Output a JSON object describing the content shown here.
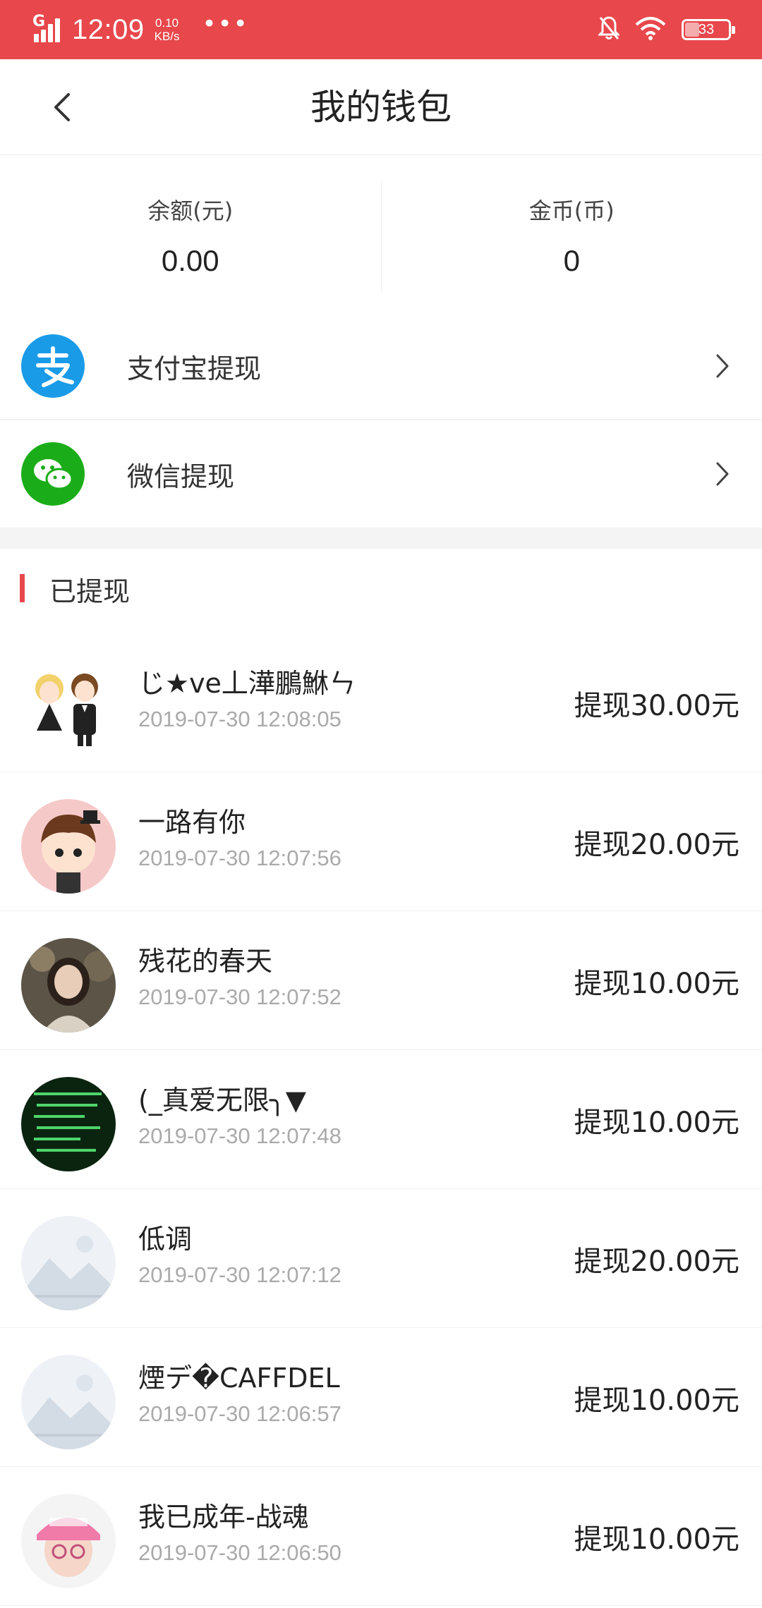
{
  "status_bar": {
    "network": "G",
    "time": "12:09",
    "speed_value": "0.10",
    "speed_unit": "KB/s",
    "more": "•••",
    "battery": "33"
  },
  "nav": {
    "title": "我的钱包"
  },
  "balance": {
    "yuan_label": "余额(元)",
    "yuan_value": "0.00",
    "coin_label": "金币(币)",
    "coin_value": "0"
  },
  "withdraw_options": [
    {
      "label": "支付宝提现",
      "icon": "alipay-icon",
      "color": "#1a9be8"
    },
    {
      "label": "微信提现",
      "icon": "wechat-icon",
      "color": "#1aad19"
    }
  ],
  "records_section": {
    "title": "已提现",
    "accent": "#e8474b"
  },
  "records": [
    {
      "name": "じ★ve丄澕鵬鮴ㄣ",
      "time": "2019-07-30 12:08:05",
      "amount": "提现30.00元",
      "avatar": "couple-cartoon"
    },
    {
      "name": "一路有你",
      "time": "2019-07-30 12:07:56",
      "amount": "提现20.00元",
      "avatar": "cartoon-boy"
    },
    {
      "name": "残花的春天",
      "time": "2019-07-30 12:07:52",
      "amount": "提现10.00元",
      "avatar": "photo-woman"
    },
    {
      "name": "(_真爱无限╮▼",
      "time": "2019-07-30 12:07:48",
      "amount": "提现10.00元",
      "avatar": "green-text"
    },
    {
      "name": "低调",
      "time": "2019-07-30 12:07:12",
      "amount": "提现20.00元",
      "avatar": "placeholder"
    },
    {
      "name": "煙デ�САFFDEL",
      "time": "2019-07-30 12:06:57",
      "amount": "提现10.00元",
      "avatar": "placeholder"
    },
    {
      "name": "我已成年-战魂",
      "time": "2019-07-30 12:06:50",
      "amount": "提现10.00元",
      "avatar": "pink-hat"
    }
  ]
}
